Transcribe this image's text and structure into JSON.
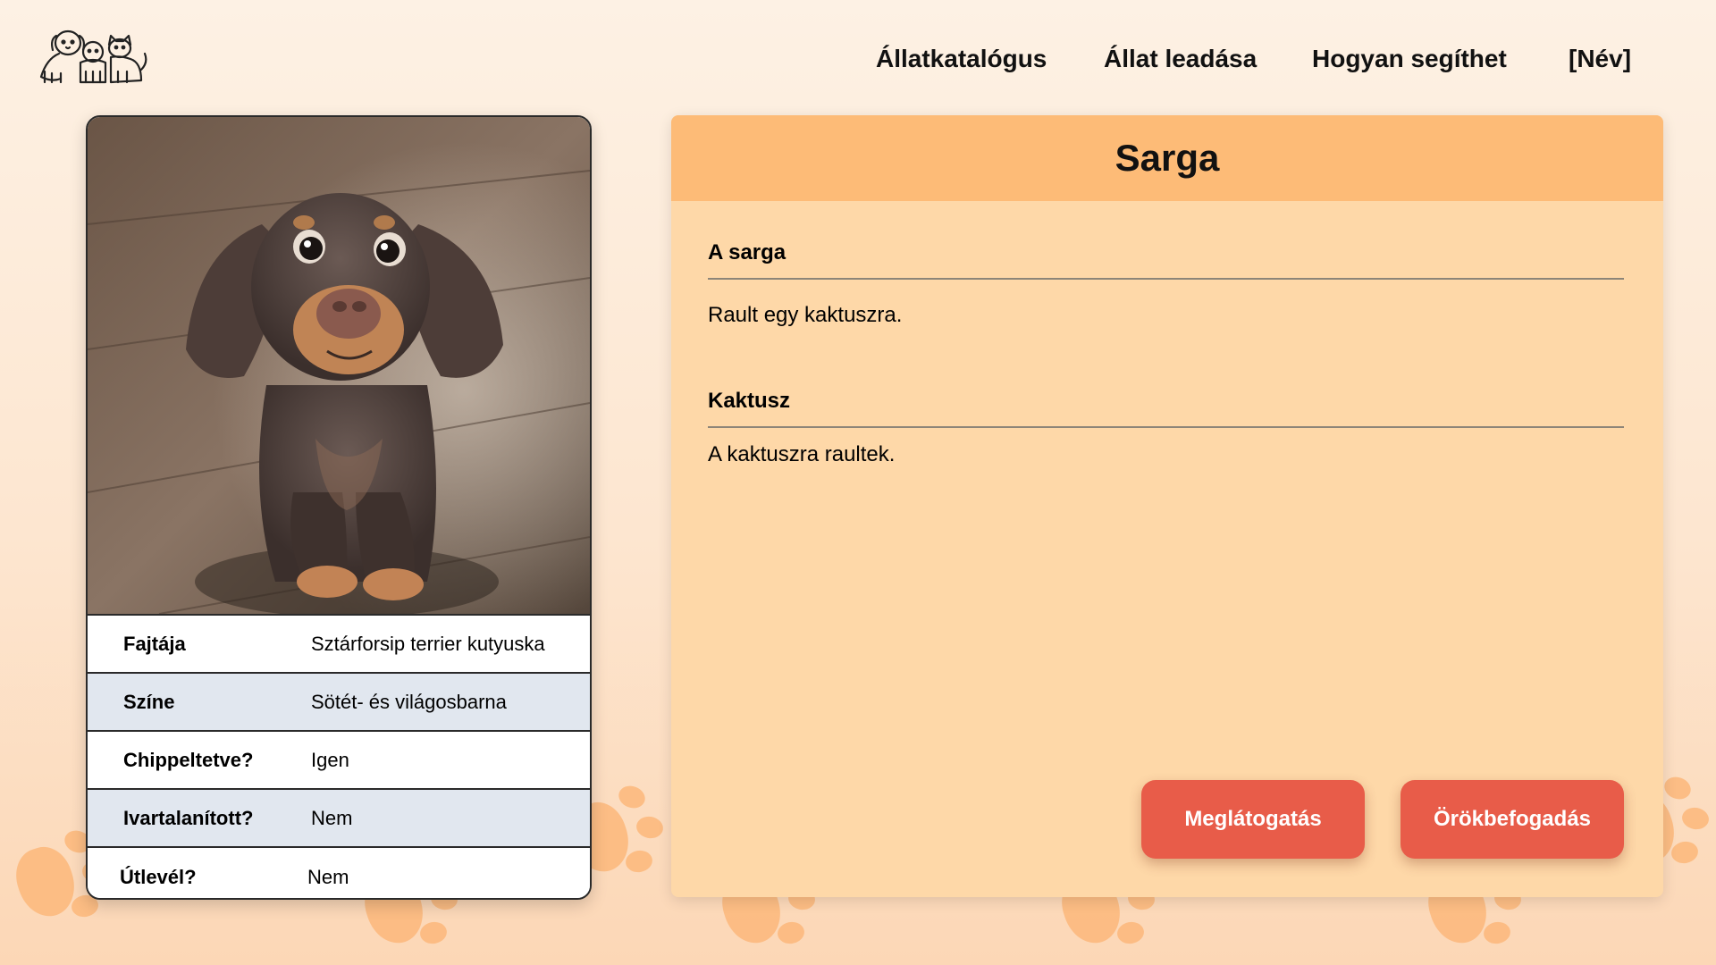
{
  "nav": {
    "items": [
      {
        "label": "Állatkatalógus"
      },
      {
        "label": "Állat leadása"
      },
      {
        "label": "Hogyan segíthet"
      },
      {
        "label": "[Név]"
      }
    ]
  },
  "pet": {
    "name": "Sarga",
    "photo_icon": "dachshund-puppy-photo",
    "details": [
      {
        "label": "Fajtája",
        "value": "Sztárforsip terrier kutyuska"
      },
      {
        "label": "Színe",
        "value": "Sötét- és világosbarna"
      },
      {
        "label": "Chippeltetve?",
        "value": "Igen"
      },
      {
        "label": "Ivartalanított?",
        "value": "Nem"
      },
      {
        "label": "Útlevél?",
        "value": "Nem"
      }
    ]
  },
  "sections": [
    {
      "title": "A sarga",
      "body": "Rault egy kaktuszra."
    },
    {
      "title": "Kaktusz",
      "body": "A kaktuszra raultek."
    }
  ],
  "actions": {
    "visit_label": "Meglátogatás",
    "adopt_label": "Örökbefogadás"
  },
  "colors": {
    "header_orange": "#fdbb77",
    "panel_peach": "#fed8a8",
    "button_red": "#e85c49",
    "row_alt": "#e1e7ef"
  }
}
